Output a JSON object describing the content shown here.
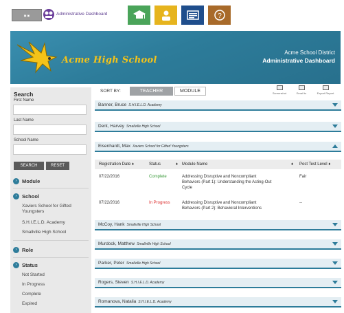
{
  "top": {
    "admin_link": "Administrative Dashboard",
    "nav_icons": [
      "graduation-cap-icon",
      "user-icon",
      "report-icon",
      "help-icon"
    ],
    "help_glyph": "?"
  },
  "banner": {
    "school": "Acme High School",
    "district": "Acme School District",
    "title": "Administrative Dashboard"
  },
  "sidebar": {
    "search_title": "Search",
    "first_name_label": "First Name",
    "last_name_label": "Last Name",
    "school_name_label": "School Name",
    "search_button": "SEARCH",
    "reset_button": "RESET",
    "module_label": "Module",
    "school_label": "School",
    "schools": [
      "Xaviers School for Gifted Youngsters",
      "S.H.I.E.L.D. Academy",
      "Smallville High School"
    ],
    "role_label": "Role",
    "status_label": "Status",
    "statuses": [
      "Not Started",
      "In Progress",
      "Complete",
      "Expired"
    ]
  },
  "sort": {
    "label": "SORT BY:",
    "teacher": "TEACHER",
    "module": "MODULE"
  },
  "tools": [
    "Screenshot",
    "Email to",
    "Export Report"
  ],
  "teachers": [
    {
      "name": "Banner, Bruce",
      "school": "S.H.I.E.L.D. Academy"
    },
    {
      "name": "Dent, Harvey",
      "school": "Smallville High School"
    },
    {
      "name": "Eisenhardt, Max",
      "school": "Xaviers School for Gifted Youngsters"
    },
    {
      "name": "McCoy, Hank",
      "school": "Smallville High School"
    },
    {
      "name": "Murdock, Matthew",
      "school": "Smallville High School"
    },
    {
      "name": "Parker, Peter",
      "school": "Smallville High School"
    },
    {
      "name": "Rogers, Steven",
      "school": "S.H.I.E.L.D. Academy"
    },
    {
      "name": "Romanova, Natalia",
      "school": "S.H.I.E.L.D. Academy"
    }
  ],
  "table": {
    "headers": [
      "Registration Date ♦",
      "Status",
      "♦",
      "Module Name",
      "♦",
      "Post Test Level ♦"
    ],
    "rows": [
      {
        "date": "07/22/2016",
        "status": "Complete",
        "module_lines": [
          "Addressing Disruptive and Noncompliant",
          "Behaviors (Part 1): Understanding the Acting-Out",
          "Cycle"
        ],
        "level": "Fair"
      },
      {
        "date": "07/22/2016",
        "status": "In Progress",
        "module_lines": [
          "Addressing Disruptive and Noncompliant",
          "Behaviors (Part 2): Behavioral Interventions"
        ],
        "level": "--"
      }
    ]
  },
  "colors": {
    "accent": "#2d7c9a",
    "school_gold": "#f4c319",
    "complete": "#3a9a3a",
    "in_progress": "#dd3333"
  }
}
